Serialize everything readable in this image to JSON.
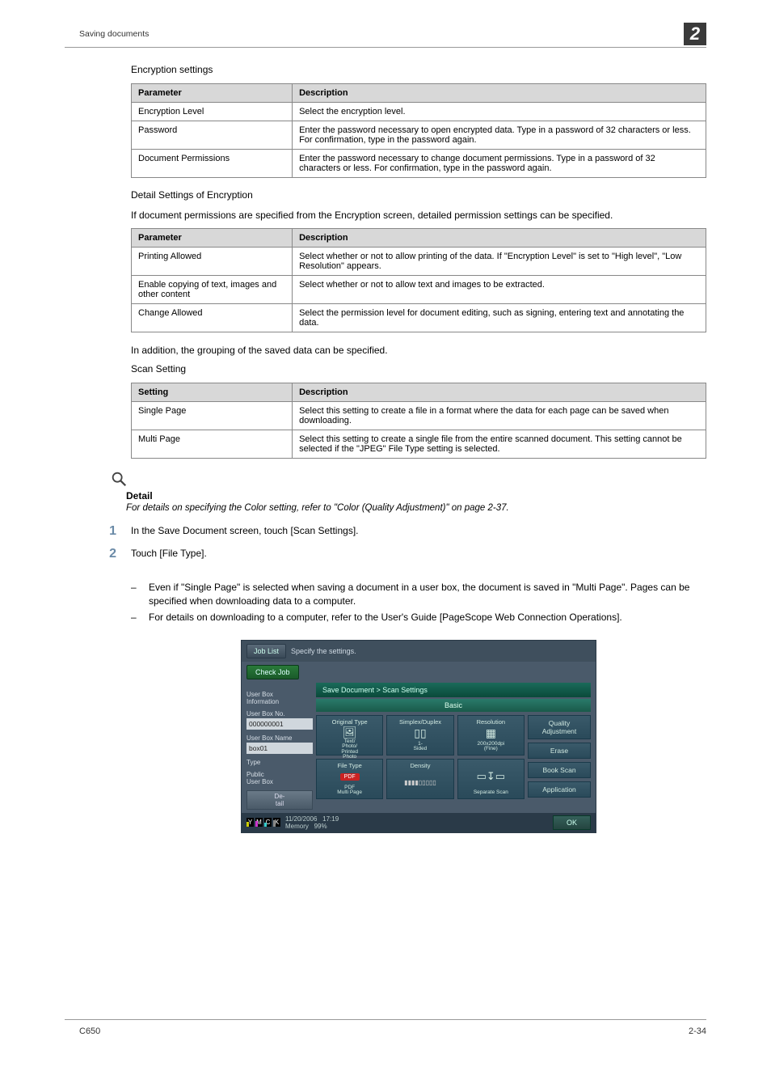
{
  "header": {
    "section": "Saving documents",
    "chapter": "2"
  },
  "s_encryption_settings": {
    "title": "Encryption settings",
    "col_param": "Parameter",
    "col_desc": "Description",
    "rows": [
      {
        "p": "Encryption Level",
        "d": "Select the encryption level."
      },
      {
        "p": "Password",
        "d": "Enter the password necessary to open encrypted data. Type in a password of 32 characters or less. For confirmation, type in the password again."
      },
      {
        "p": "Document Permissions",
        "d": "Enter the password necessary to change document permissions. Type in a password of 32 characters or less. For confirmation, type in the password again."
      }
    ]
  },
  "s_detail_encryption": {
    "title": "Detail Settings of Encryption",
    "intro": "If document permissions are specified from the Encryption screen, detailed permission settings can be specified.",
    "col_param": "Parameter",
    "col_desc": "Description",
    "rows": [
      {
        "p": "Printing Allowed",
        "d": "Select whether or not to allow printing of the data. If \"Encryption Level\" is set to \"High level\", \"Low Resolution\" appears."
      },
      {
        "p": "Enable copying of text, images and other content",
        "d": "Select whether or not to allow text and images to be extracted."
      },
      {
        "p": "Change Allowed",
        "d": "Select the permission level for document editing, such as signing, entering text and annotating the data."
      }
    ]
  },
  "grouping_text": "In addition, the grouping of the saved data can be specified.",
  "s_scan_setting": {
    "title": "Scan Setting",
    "col_setting": "Setting",
    "col_desc": "Description",
    "rows": [
      {
        "s": "Single Page",
        "d": "Select this setting to create a file in a format where the data for each page can be saved when downloading."
      },
      {
        "s": "Multi Page",
        "d": "Select this setting to create a single file from the entire scanned document. This setting cannot be selected if the \"JPEG\" File Type setting is selected."
      }
    ]
  },
  "detail_note": {
    "label": "Detail",
    "text": "For details on specifying the Color setting, refer to \"Color (Quality Adjustment)\" on page 2-37."
  },
  "steps": {
    "s1": {
      "num": "1",
      "text": "In the Save Document screen, touch [Scan Settings]."
    },
    "s2": {
      "num": "2",
      "text": "Touch [File Type].",
      "subs": [
        "Even if \"Single Page\" is selected when saving a document in a user box, the document is saved in \"Multi Page\". Pages can be specified when downloading data to a computer.",
        "For details on downloading to a computer, refer to the User's Guide [PageScope Web Connection Operations]."
      ]
    }
  },
  "device": {
    "top": {
      "job_list": "Job List",
      "specify": "Specify the settings.",
      "check_job": "Check Job"
    },
    "side": {
      "info": "User Box\nInformation",
      "boxno_l": "User Box No.",
      "boxno_v": "000000001",
      "boxname_l": "User Box Name",
      "boxname_v": "box01",
      "type_l": "Type",
      "type_v": "Public\nUser Box",
      "detail": "De-\ntail"
    },
    "main": {
      "breadcrumb": "Save Document > Scan Settings",
      "tab_basic": "Basic",
      "tiles": {
        "original_type": {
          "hdr": "Original Type",
          "sub": "Text/\nPhoto/\nPrinted\nPhoto"
        },
        "simplex_duplex": {
          "hdr": "Simplex/Duplex",
          "sub": "1-\nSided"
        },
        "resolution": {
          "hdr": "Resolution",
          "sub": "200x200dpi\n(Fine)"
        },
        "file_type": {
          "hdr": "File Type",
          "badge": "PDF",
          "sub": "PDF\nMulti Page"
        },
        "density": {
          "hdr": "Density"
        },
        "separate_scan": {
          "hdr": "Separate Scan"
        }
      },
      "right": {
        "quality": "Quality\nAdjustment",
        "erase": "Erase",
        "book_scan": "Book Scan",
        "application": "Application"
      }
    },
    "footer": {
      "date": "11/20/2006",
      "time": "17:19",
      "memory": "Memory",
      "mem_pct": "99%",
      "ok": "OK"
    }
  },
  "footer": {
    "model": "C650",
    "page": "2-34"
  }
}
